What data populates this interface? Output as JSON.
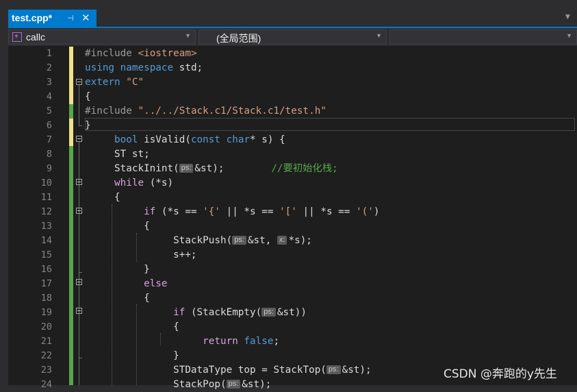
{
  "tab": {
    "title": "test.cpp*",
    "pin": "⊣",
    "close": "✕"
  },
  "navbar": {
    "project": "callc",
    "scope": "(全局范围)",
    "member": ""
  },
  "editor": {
    "lines": [
      {
        "n": "1",
        "t": "#include <iostream>"
      },
      {
        "n": "2",
        "t": "using namespace std;"
      },
      {
        "n": "3",
        "t": "extern \"C\""
      },
      {
        "n": "4",
        "t": "{"
      },
      {
        "n": "5",
        "t": "#include \"../../Stack.c1/Stack.c1/test.h\""
      },
      {
        "n": "6",
        "t": "}"
      },
      {
        "n": "7",
        "t": "     bool isValid(const char* s) {"
      },
      {
        "n": "8",
        "t": "     ST st;"
      },
      {
        "n": "9",
        "t": "     StackInint(ps:&st);        //要初始化栈;"
      },
      {
        "n": "10",
        "t": "     while (*s)"
      },
      {
        "n": "11",
        "t": "     {"
      },
      {
        "n": "12",
        "t": "          if (*s == '{' || *s == '[' || *s == '(')"
      },
      {
        "n": "13",
        "t": "          {"
      },
      {
        "n": "14",
        "t": "               StackPush(ps:&st, x:*s);"
      },
      {
        "n": "15",
        "t": "               s++;"
      },
      {
        "n": "16",
        "t": "          }"
      },
      {
        "n": "17",
        "t": "          else"
      },
      {
        "n": "18",
        "t": "          {"
      },
      {
        "n": "19",
        "t": "               if (StackEmpty(ps:&st))"
      },
      {
        "n": "20",
        "t": "               {"
      },
      {
        "n": "21",
        "t": "                    return false;"
      },
      {
        "n": "22",
        "t": "               }"
      },
      {
        "n": "23",
        "t": "               STDataType top = StackTop(ps:&st);"
      },
      {
        "n": "24",
        "t": "               StackPop(ps:&st);"
      }
    ],
    "hint_ps": "ps:",
    "hint_x": "x:"
  },
  "watermark": "CSDN @奔跑的y先生",
  "colors": {
    "accent": "#007acc",
    "keyword": "#569cd6",
    "control": "#d8a0df",
    "string": "#d69d85",
    "comment": "#57a64a"
  }
}
